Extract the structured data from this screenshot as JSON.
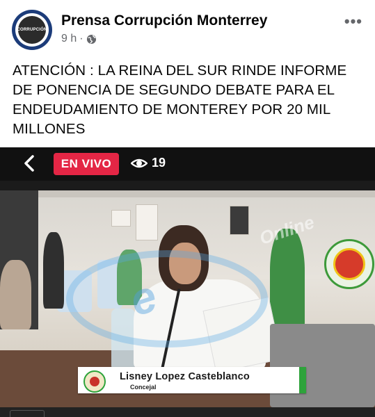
{
  "post": {
    "page_name": "Prensa Corrupción Monterrey",
    "time": "9 h",
    "separator": "·",
    "avatar_text": "CORRUPCIÓN",
    "text": "ATENCIÓN : LA REINA DEL SUR RINDE INFORME DE PONENCIA DE SEGUNDO DEBATE PARA EL ENDEUDAMIENTO DE MONTEREY POR 20 MIL MILLONES"
  },
  "video": {
    "live_label": "EN VIVO",
    "viewer_count": "19",
    "watermark_text": "Online",
    "lower_third": {
      "name": "Lisney Lopez Casteblanco",
      "role": "Concejal"
    }
  },
  "colors": {
    "live_red": "#e42645",
    "lower_third_green": "#2ea33b",
    "meta_gray": "#65676b"
  },
  "icons": [
    "globe-icon",
    "more-options-icon",
    "back-arrow-icon",
    "eye-icon"
  ]
}
